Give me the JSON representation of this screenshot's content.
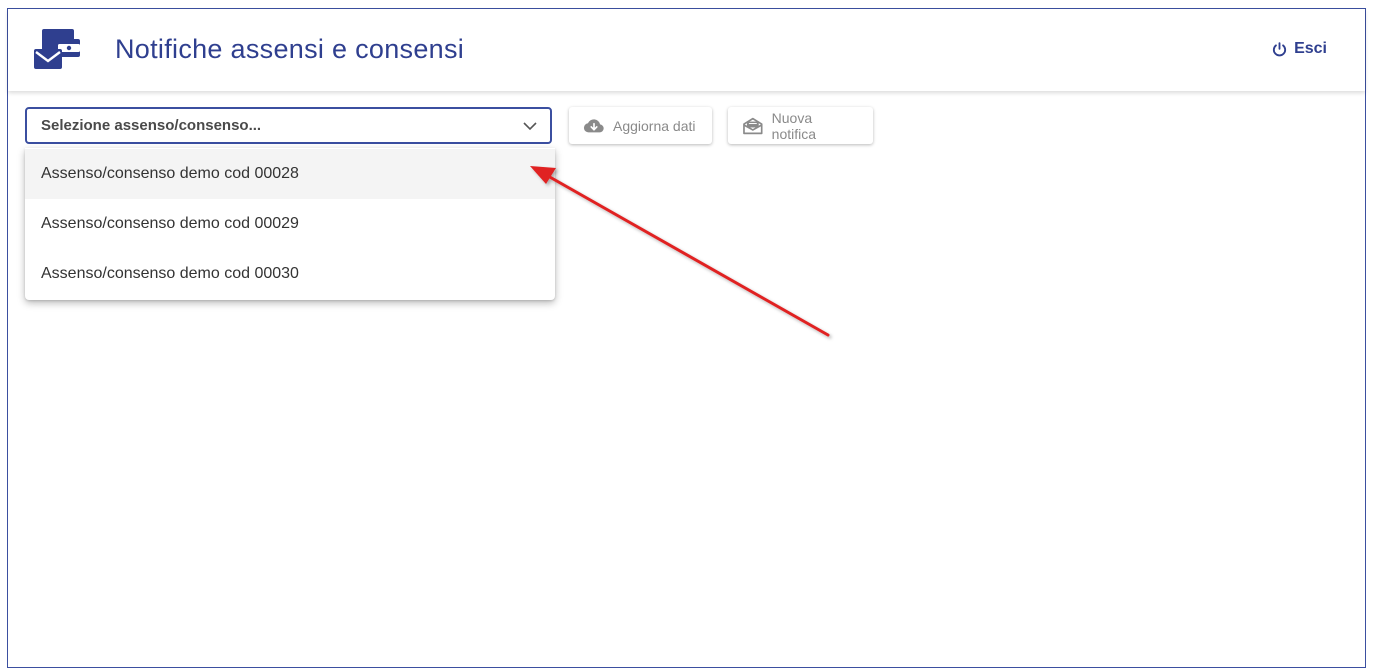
{
  "header": {
    "title": "Notifiche assensi e consensi",
    "logout_label": "Esci",
    "app_icon": "envelope-wallet-icon",
    "logout_icon": "power-icon"
  },
  "toolbar": {
    "select_placeholder": "Selezione assenso/consenso...",
    "select_icon": "chevron-down-icon",
    "refresh_label": "Aggiorna dati",
    "refresh_icon": "cloud-download-icon",
    "new_label": "Nuova notifica",
    "new_icon": "envelope-open-icon"
  },
  "dropdown": {
    "options": [
      "Assenso/consenso demo cod 00028",
      "Assenso/consenso demo cod 00029",
      "Assenso/consenso demo cod 00030"
    ],
    "hovered_index": 0
  },
  "colors": {
    "accent": "#2f3f8f",
    "border": "#3b4fa0",
    "disabled_text": "#8a8a8a",
    "annotation_arrow": "#e02020"
  }
}
